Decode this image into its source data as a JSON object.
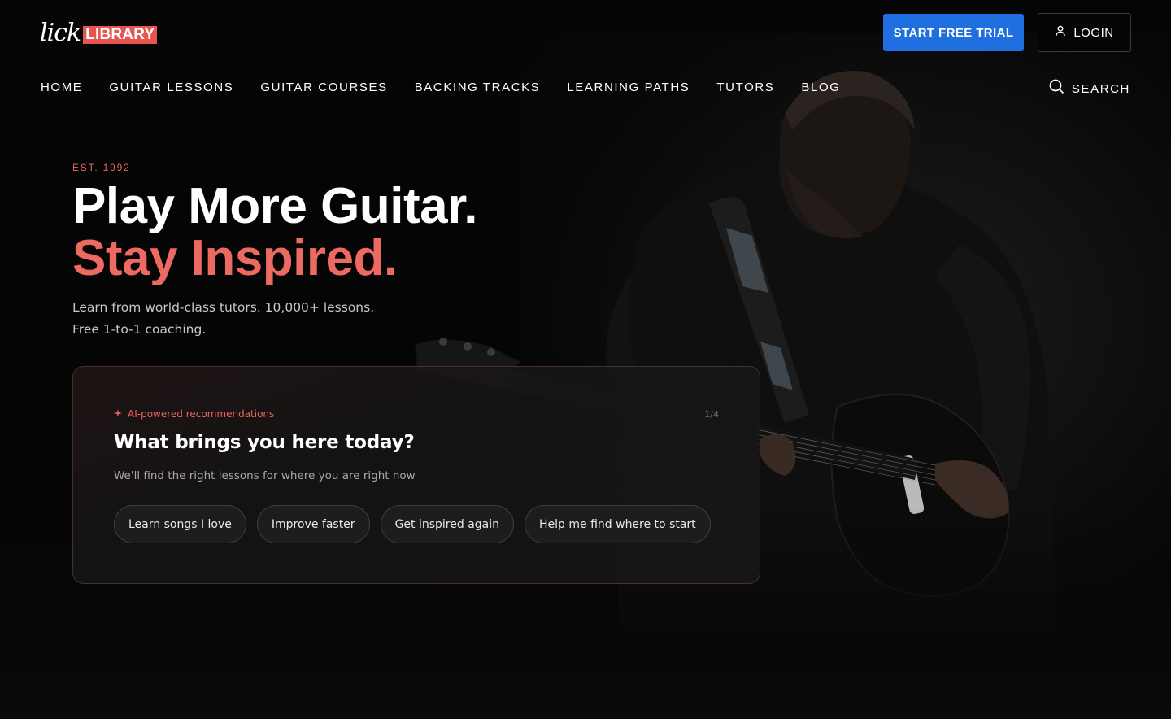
{
  "brand": {
    "logo_script": "lick",
    "logo_box": "LIBRARY",
    "accent": "#e8544f"
  },
  "header": {
    "trial_label": "START FREE TRIAL",
    "trial_color": "#1f6fe0",
    "login_label": "LOGIN",
    "login_icon": "user-icon"
  },
  "nav": {
    "items": [
      {
        "label": "HOME"
      },
      {
        "label": "GUITAR LESSONS"
      },
      {
        "label": "GUITAR COURSES"
      },
      {
        "label": "BACKING TRACKS"
      },
      {
        "label": "LEARNING PATHS"
      },
      {
        "label": "TUTORS"
      },
      {
        "label": "BLOG"
      }
    ],
    "search_label": "SEARCH",
    "search_icon": "search-icon"
  },
  "hero": {
    "eyebrow": "EST. 1992",
    "headline_line1": "Play More Guitar.",
    "headline_line2": "Stay Inspired.",
    "subtext_line1": "Learn from world-class tutors. 10,000+ lessons.",
    "subtext_line2": "Free 1-to-1 coaching.",
    "background_image": "guitarist-photo"
  },
  "quiz": {
    "tag": "AI-powered recommendations",
    "tag_icon": "sparkle-icon",
    "step": "1/4",
    "question": "What brings you here today?",
    "subtitle": "We'll find the right lessons for where you are right now",
    "options": [
      {
        "label": "Learn songs I love"
      },
      {
        "label": "Improve faster"
      },
      {
        "label": "Get inspired again"
      },
      {
        "label": "Help me find where to start"
      }
    ]
  }
}
